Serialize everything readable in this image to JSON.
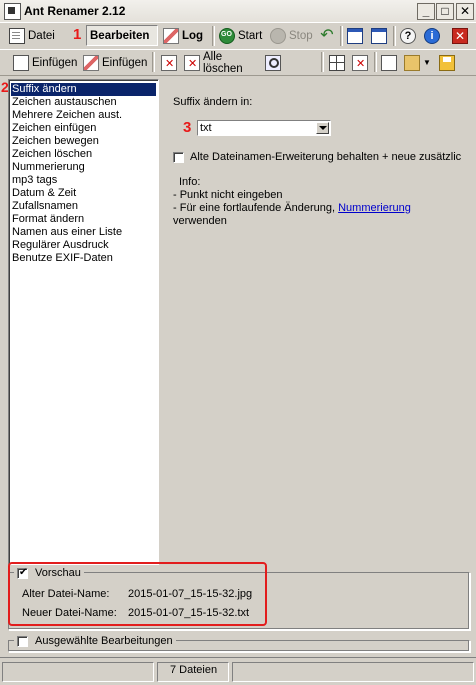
{
  "window": {
    "title": "Ant Renamer 2.12",
    "minimize": "_",
    "maximize": "□",
    "close": "✕"
  },
  "toolbar1": {
    "datei": "Datei",
    "bearbeiten": "Bearbeiten",
    "log": "Log",
    "start": "Start",
    "stop": "Stop"
  },
  "toolbar2": {
    "einfuegen1": "Einfügen",
    "einfuegen2": "Einfügen",
    "alle_loeschen": "Alle löschen"
  },
  "callouts": {
    "one": "1",
    "two": "2",
    "three": "3"
  },
  "actions": [
    "Suffix ändern",
    "Zeichen austauschen",
    "Mehrere Zeichen aust.",
    "Zeichen einfügen",
    "Zeichen bewegen",
    "Zeichen löschen",
    "Nummerierung",
    "mp3 tags",
    "Datum & Zeit",
    "Zufallsnamen",
    "Format ändern",
    "Namen aus einer Liste",
    "Regulärer Ausdruck",
    "Benutze EXIF-Daten"
  ],
  "main": {
    "suffix_label": "Suffix ändern in:",
    "suffix_value": "txt",
    "keep_ext_label": "Alte Dateinamen-Erweiterung behalten + neue zusätzlic",
    "info_title": "Info:",
    "info_line1": "- Punkt nicht eingeben",
    "info_line2": "- Für eine fortlaufende Änderung,",
    "info_link": "Nummerierung",
    "info_line3": "verwenden"
  },
  "preview": {
    "title": "Vorschau",
    "old_label": "Alter Datei-Name:",
    "old_value": "2015-01-07_15-15-32.jpg",
    "new_label": "Neuer Datei-Name:",
    "new_value": "2015-01-07_15-15-32.txt"
  },
  "selected_ops": {
    "label": "Ausgewählte Bearbeitungen"
  },
  "status": {
    "files": "7 Dateien"
  },
  "colors": {
    "selection": "#0a246a",
    "callout": "#e81a1a",
    "face": "#d4d0c8"
  }
}
